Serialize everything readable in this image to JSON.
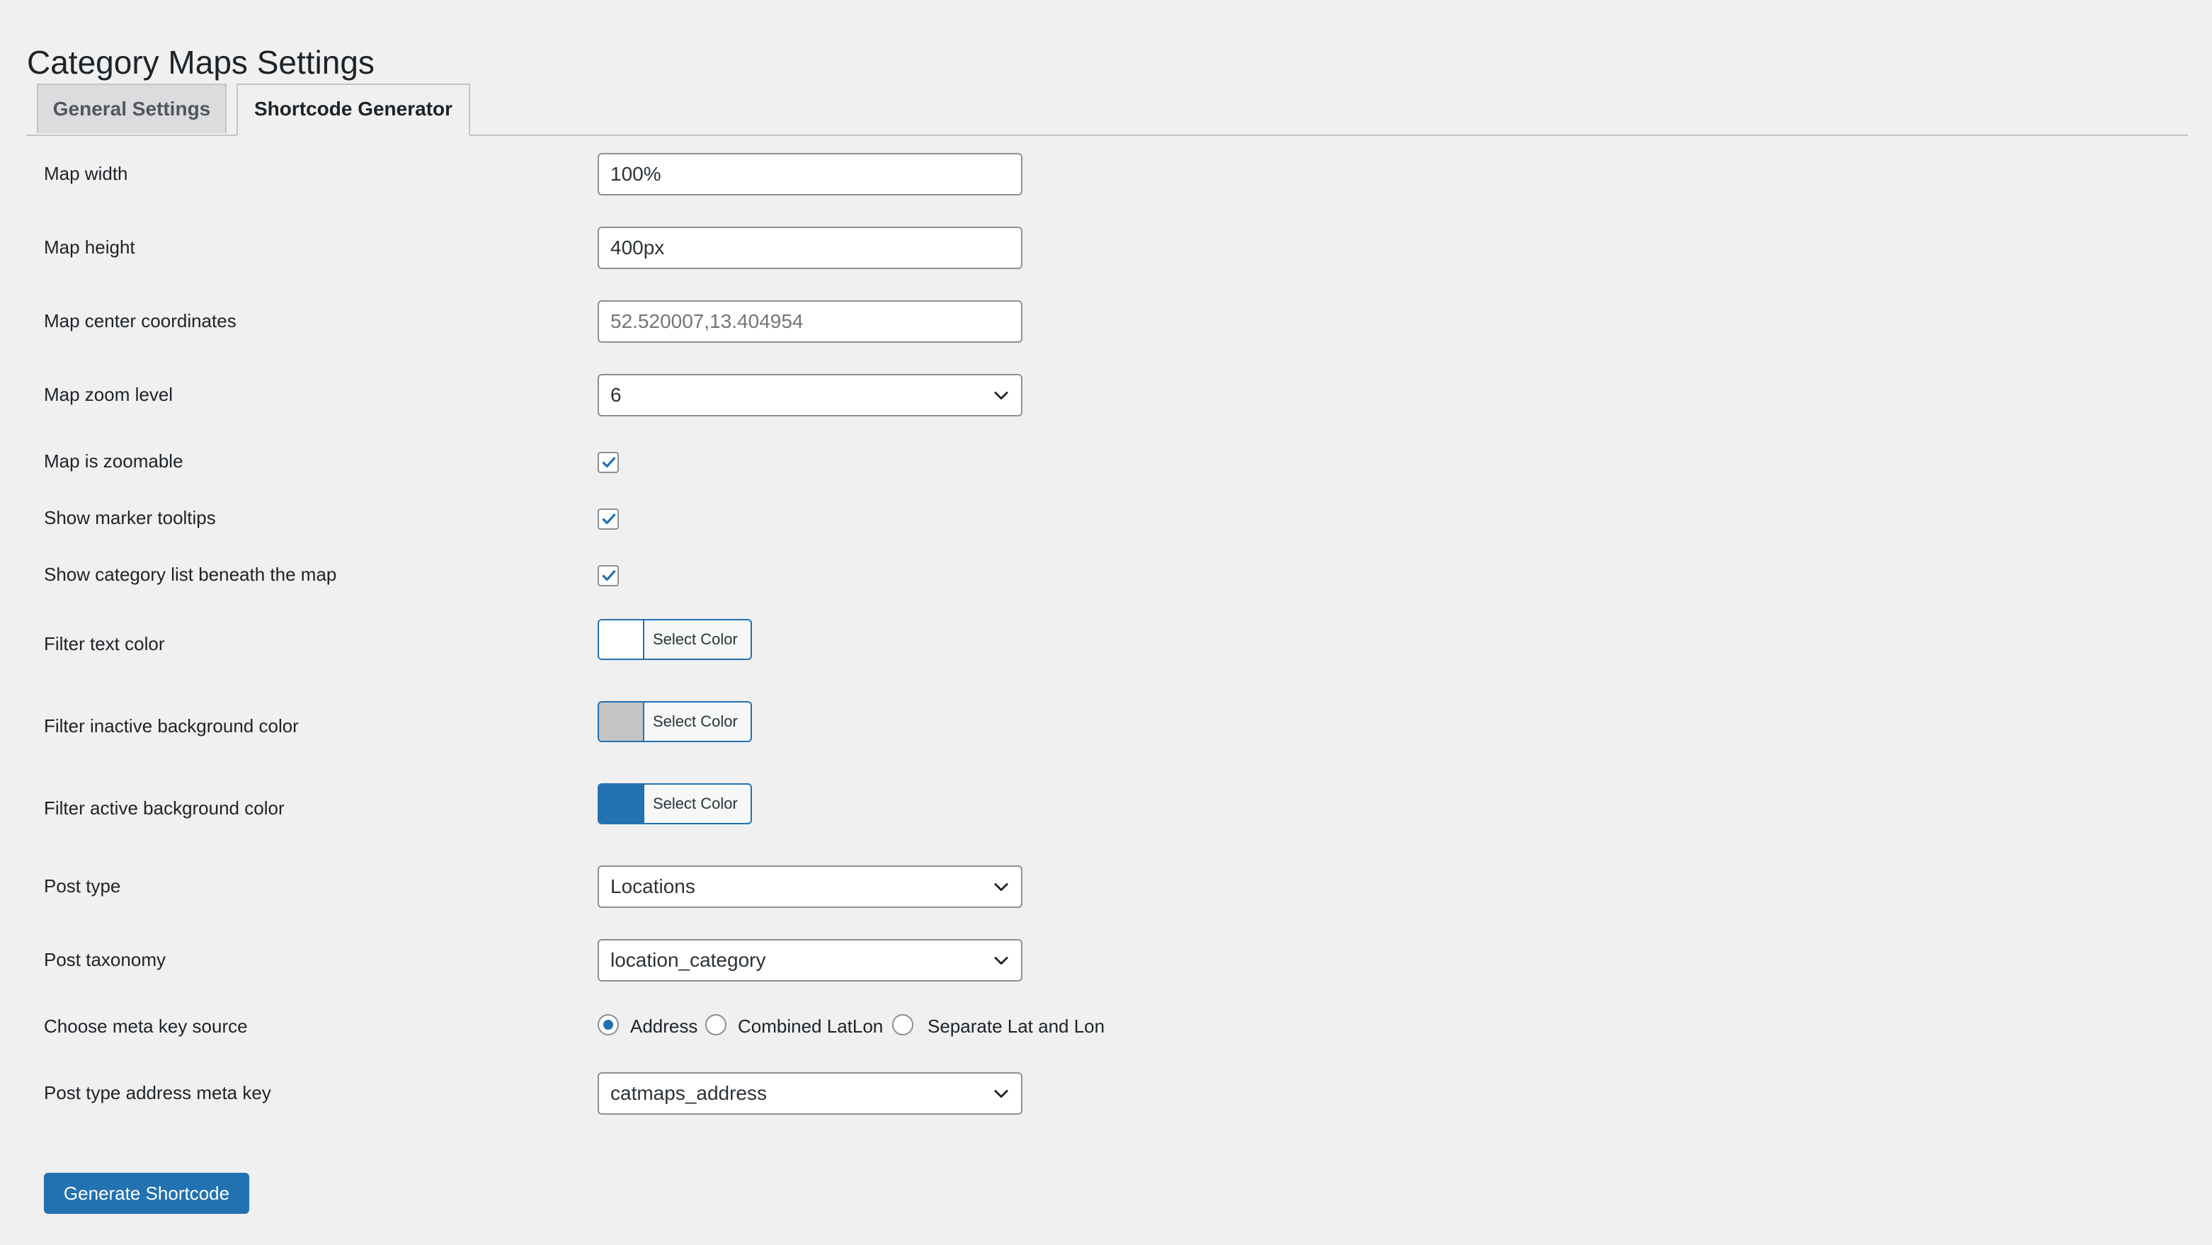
{
  "page": {
    "title": "Category Maps Settings"
  },
  "tabs": [
    {
      "label": "General Settings",
      "active": false
    },
    {
      "label": "Shortcode Generator",
      "active": true
    }
  ],
  "fields": {
    "map_width": {
      "label": "Map width",
      "value": "100%"
    },
    "map_height": {
      "label": "Map height",
      "value": "400px"
    },
    "map_center": {
      "label": "Map center coordinates",
      "placeholder": "52.520007,13.404954"
    },
    "map_zoom": {
      "label": "Map zoom level",
      "value": "6"
    },
    "zoomable": {
      "label": "Map is zoomable",
      "checked": true
    },
    "tooltips": {
      "label": "Show marker tooltips",
      "checked": true
    },
    "category_list": {
      "label": "Show category list beneath the map",
      "checked": true
    },
    "filter_text_color": {
      "label": "Filter text color",
      "button": "Select Color",
      "color": "#ffffff"
    },
    "filter_inactive_bg": {
      "label": "Filter inactive background color",
      "button": "Select Color",
      "color": "#c4c4c4"
    },
    "filter_active_bg": {
      "label": "Filter active background color",
      "button": "Select Color",
      "color": "#2271b1"
    },
    "post_type": {
      "label": "Post type",
      "value": "Locations"
    },
    "post_taxonomy": {
      "label": "Post taxonomy",
      "value": "location_category"
    },
    "meta_source": {
      "label": "Choose meta key source",
      "options": [
        "Address",
        "Combined LatLon",
        "Separate Lat and Lon"
      ],
      "selected": "Address"
    },
    "address_meta_key": {
      "label": "Post type address meta key",
      "value": "catmaps_address"
    }
  },
  "actions": {
    "generate": "Generate Shortcode"
  },
  "icons": {
    "select_arrow": "chevron-down-icon",
    "checkmark": "check-icon"
  },
  "colors": {
    "primary": "#2271b1",
    "background": "#f0f0f1",
    "border": "#8c8f94"
  }
}
